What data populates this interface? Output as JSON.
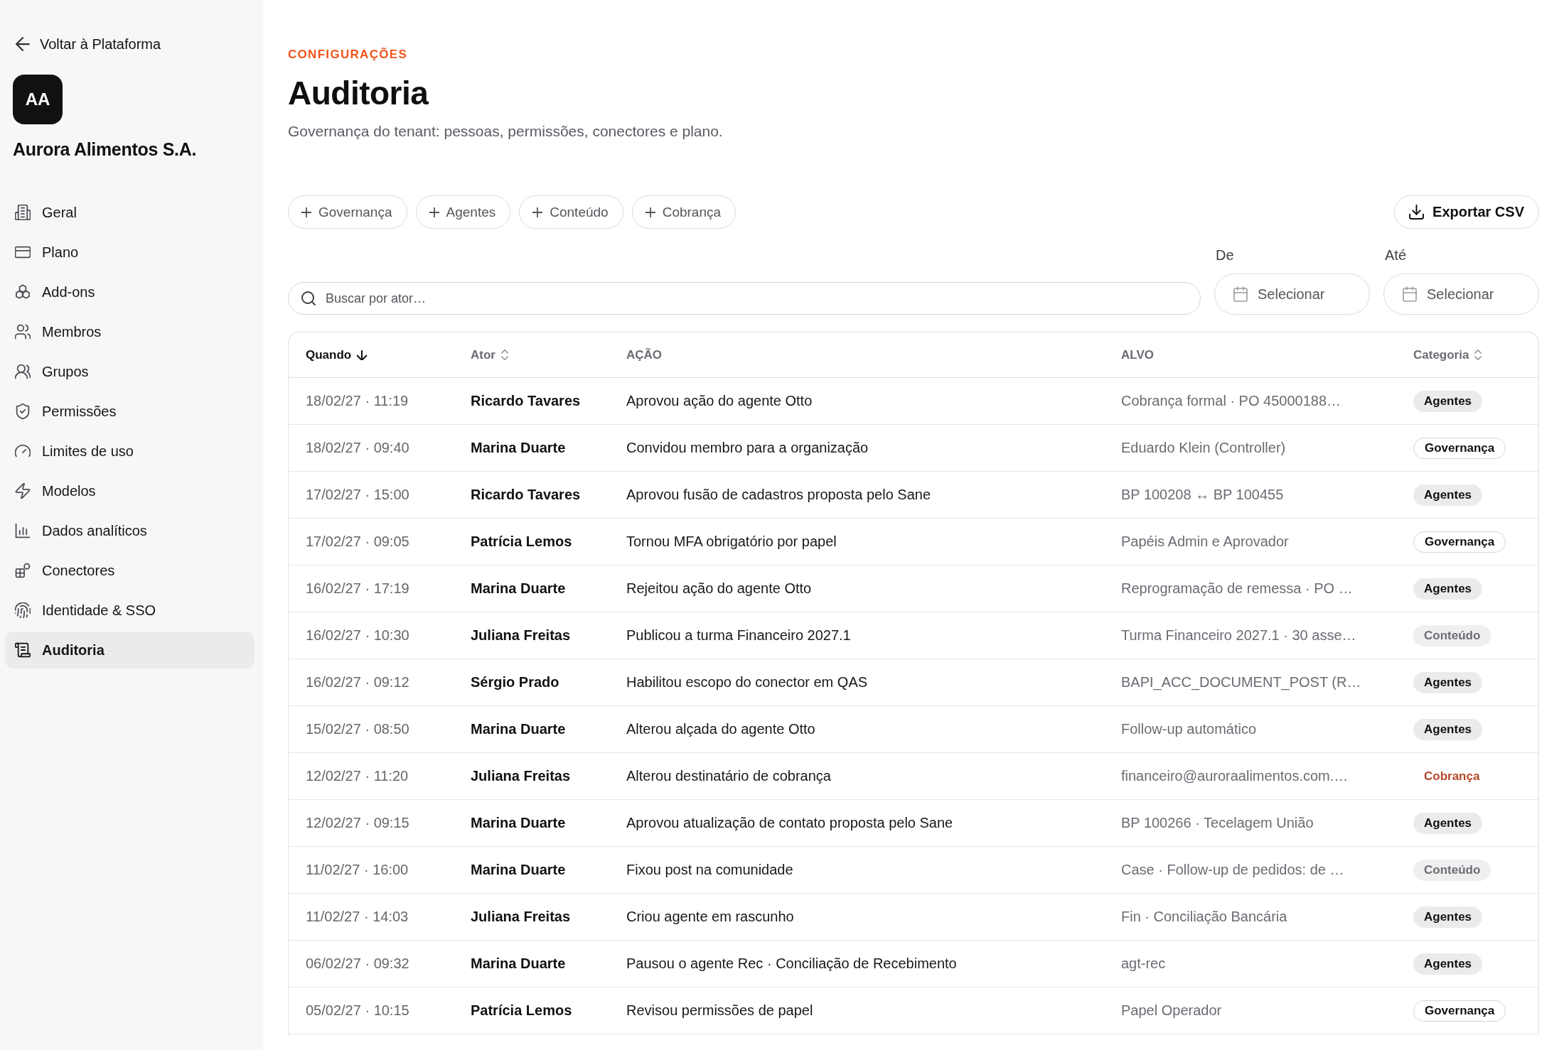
{
  "sidebar": {
    "back_link": "Voltar à Plataforma",
    "workspace": {
      "initials": "AA",
      "name": "Aurora Alimentos S.A."
    },
    "items": [
      {
        "label": "Geral",
        "selected": false
      },
      {
        "label": "Plano",
        "selected": false
      },
      {
        "label": "Add-ons",
        "selected": false
      },
      {
        "label": "Membros",
        "selected": false
      },
      {
        "label": "Grupos",
        "selected": false
      },
      {
        "label": "Permissões",
        "selected": false
      },
      {
        "label": "Limites de uso",
        "selected": false
      },
      {
        "label": "Modelos",
        "selected": false
      },
      {
        "label": "Dados analíticos",
        "selected": false
      },
      {
        "label": "Conectores",
        "selected": false
      },
      {
        "label": "Identidade & SSO",
        "selected": false
      },
      {
        "label": "Auditoria",
        "selected": true
      }
    ]
  },
  "header": {
    "eyebrow": "CONFIGURAÇÕES",
    "title": "Auditoria",
    "subtitle": "Governança do tenant: pessoas, permissões, conectores e plano."
  },
  "filter_chips": [
    "Governança",
    "Agentes",
    "Conteúdo",
    "Cobrança"
  ],
  "export_button": "Exportar CSV",
  "search": {
    "placeholder": "Buscar por ator…"
  },
  "date_range": [
    {
      "label": "De",
      "button_label": "Selecionar"
    },
    {
      "label": "Até",
      "button_label": "Selecionar"
    }
  ],
  "table": {
    "columns": [
      {
        "label": "Quando",
        "sortable": true,
        "sorted": true
      },
      {
        "label": "Ator",
        "sortable": true,
        "sorted": false
      },
      {
        "label": "AÇÃO",
        "sortable": false,
        "sorted": false
      },
      {
        "label": "ALVO",
        "sortable": false,
        "sorted": false
      },
      {
        "label": "Categoria",
        "sortable": true,
        "sorted": false
      }
    ],
    "rows": [
      {
        "when": "18/02/27 · 11:19",
        "actor": "Ricardo Tavares",
        "action": "Aprovou ação do agente Otto",
        "target": "Cobrança formal · PO 45000188…",
        "category": {
          "label": "Agentes",
          "kind": "filled"
        }
      },
      {
        "when": "18/02/27 · 09:40",
        "actor": "Marina Duarte",
        "action": "Convidou membro para a organização",
        "target": "Eduardo Klein (Controller)",
        "category": {
          "label": "Governança",
          "kind": "outline"
        }
      },
      {
        "when": "17/02/27 · 15:00",
        "actor": "Ricardo Tavares",
        "action": "Aprovou fusão de cadastros proposta pelo Sane",
        "target": "BP 100208 ↔ BP 100455",
        "category": {
          "label": "Agentes",
          "kind": "filled"
        }
      },
      {
        "when": "17/02/27 · 09:05",
        "actor": "Patrícia Lemos",
        "action": "Tornou MFA obrigatório por papel",
        "target": "Papéis Admin e Aprovador",
        "category": {
          "label": "Governança",
          "kind": "outline"
        }
      },
      {
        "when": "16/02/27 · 17:19",
        "actor": "Marina Duarte",
        "action": "Rejeitou ação do agente Otto",
        "target": "Reprogramação de remessa · PO …",
        "category": {
          "label": "Agentes",
          "kind": "filled"
        }
      },
      {
        "when": "16/02/27 · 10:30",
        "actor": "Juliana Freitas",
        "action": "Publicou a turma Financeiro 2027.1",
        "target": "Turma Financeiro 2027.1 · 30 asse…",
        "category": {
          "label": "Conteúdo",
          "kind": "muted"
        }
      },
      {
        "when": "16/02/27 · 09:12",
        "actor": "Sérgio Prado",
        "action": "Habilitou escopo do conector em QAS",
        "target": "BAPI_ACC_DOCUMENT_POST (R…",
        "category": {
          "label": "Agentes",
          "kind": "filled"
        }
      },
      {
        "when": "15/02/27 · 08:50",
        "actor": "Marina Duarte",
        "action": "Alterou alçada do agente Otto",
        "target": "Follow-up automático",
        "category": {
          "label": "Agentes",
          "kind": "filled"
        }
      },
      {
        "when": "12/02/27 · 11:20",
        "actor": "Juliana Freitas",
        "action": "Alterou destinatário de cobrança",
        "target": "financeiro@auroraalimentos.com.…",
        "category": {
          "label": "Cobrança",
          "kind": "accent"
        }
      },
      {
        "when": "12/02/27 · 09:15",
        "actor": "Marina Duarte",
        "action": "Aprovou atualização de contato proposta pelo Sane",
        "target": "BP 100266 · Tecelagem União",
        "category": {
          "label": "Agentes",
          "kind": "filled"
        }
      },
      {
        "when": "11/02/27 · 16:00",
        "actor": "Marina Duarte",
        "action": "Fixou post na comunidade",
        "target": "Case · Follow-up de pedidos: de …",
        "category": {
          "label": "Conteúdo",
          "kind": "muted"
        }
      },
      {
        "when": "11/02/27 · 14:03",
        "actor": "Juliana Freitas",
        "action": "Criou agente em rascunho",
        "target": "Fin · Conciliação Bancária",
        "category": {
          "label": "Agentes",
          "kind": "filled"
        }
      },
      {
        "when": "06/02/27 · 09:32",
        "actor": "Marina Duarte",
        "action": "Pausou o agente Rec · Conciliação de Recebimento",
        "target": "agt-rec",
        "category": {
          "label": "Agentes",
          "kind": "filled"
        }
      },
      {
        "when": "05/02/27 · 10:15",
        "actor": "Patrícia Lemos",
        "action": "Revisou permissões de papel",
        "target": "Papel Operador",
        "category": {
          "label": "Governança",
          "kind": "outline"
        }
      }
    ]
  }
}
